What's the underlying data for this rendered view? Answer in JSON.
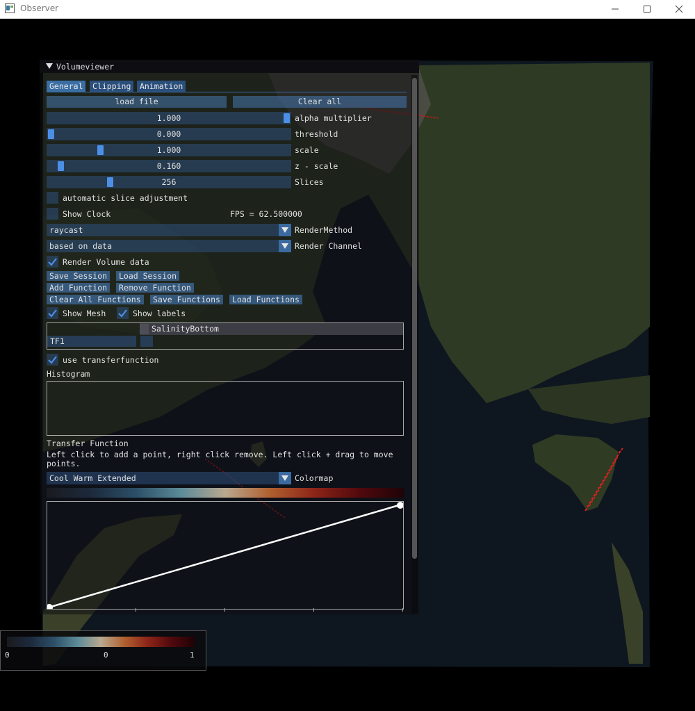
{
  "window": {
    "title": "Observer"
  },
  "panel": {
    "title": "Volumeviewer",
    "tabs": [
      "General",
      "Clipping",
      "Animation"
    ],
    "load_file": "load file",
    "clear_all": "Clear all",
    "sliders": {
      "alpha": {
        "value": "1.000",
        "label": "alpha multiplier",
        "level": 1.0
      },
      "threshold": {
        "value": "0.000",
        "label": "threshold",
        "level": 0.0
      },
      "scale": {
        "value": "1.000",
        "label": "scale",
        "level": 0.21
      },
      "zscale": {
        "value": "0.160",
        "label": "z - scale",
        "level": 0.04
      },
      "slices": {
        "value": "256",
        "label": "Slices",
        "level": 0.25
      }
    },
    "auto_slice": {
      "label": "automatic slice adjustment",
      "checked": false
    },
    "show_clock": {
      "label": "Show Clock",
      "checked": false
    },
    "fps": "FPS = 62.500000",
    "render_method": {
      "value": "raycast",
      "label": "RenderMethod"
    },
    "render_channel": {
      "value": "based on data",
      "label": "Render Channel"
    },
    "render_volume": {
      "label": "Render Volume data",
      "checked": true
    },
    "buttons": {
      "save_session": "Save Session",
      "load_session": "Load Session",
      "add_function": "Add Function",
      "remove_function": "Remove Function",
      "clear_all_functions": "Clear All Functions",
      "save_functions": "Save Functions",
      "load_functions": "Load Functions"
    },
    "show_mesh": {
      "label": "Show Mesh",
      "checked": true
    },
    "show_labels": {
      "label": "Show labels",
      "checked": true
    },
    "table": {
      "header": "SalinityBottom",
      "row_name": "TF1"
    },
    "use_tf": {
      "label": "use transferfunction",
      "checked": true
    },
    "histogram_label": "Histogram",
    "tf_label": "Transfer Function",
    "tf_help": "Left click to add a point, right click remove. Left click + drag to move points.",
    "colormap": {
      "value": "Cool Warm Extended",
      "label": "Colormap"
    }
  },
  "legend": {
    "min": "0",
    "mid": "0",
    "max": "1"
  },
  "colors": {
    "accent": "#4c8fe6",
    "button": "#426ea0",
    "cool_warm_extended": [
      "#1a1a1f",
      "#1c2a3c",
      "#2c4f68",
      "#5b8a98",
      "#b8a890",
      "#b0602f",
      "#8d2418",
      "#52090d",
      "#1e0307"
    ]
  }
}
